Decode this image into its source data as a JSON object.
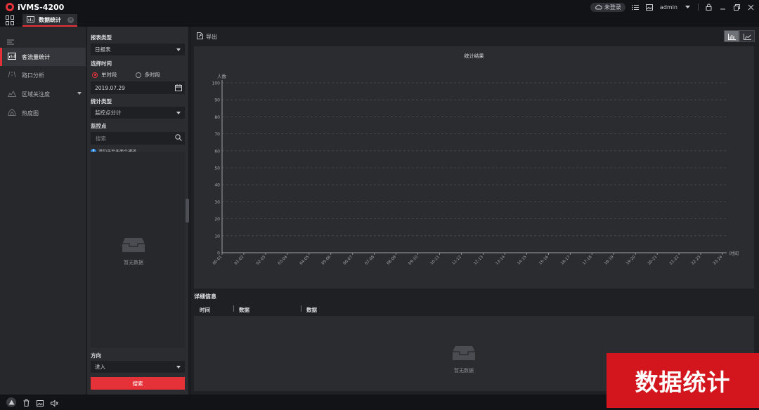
{
  "app": {
    "title": "iVMS-4200"
  },
  "titlebar": {
    "login_status": "未登录",
    "user": "admin"
  },
  "tabs": [
    {
      "label": "数据统计"
    }
  ],
  "nav": {
    "items": [
      {
        "label": "客流量统计",
        "icon": "people-counting-icon",
        "active": true
      },
      {
        "label": "路口分析",
        "icon": "intersection-icon",
        "active": false
      },
      {
        "label": "区域关注度",
        "icon": "area-heat-icon",
        "active": false,
        "expandable": true
      },
      {
        "label": "热度图",
        "icon": "heatmap-icon",
        "active": false
      }
    ]
  },
  "filters": {
    "report_type_label": "报表类型",
    "report_type_value": "日报表",
    "time_label": "选择时间",
    "time_single": "单时段",
    "time_multi": "多时段",
    "date_value": "2019.07.29",
    "stat_type_label": "统计类型",
    "stat_type_value": "监控点分计",
    "camera_label": "监控点",
    "search_placeholder": "搜索",
    "hint": "请勾选至多两个通道。",
    "empty_text": "暂无数据",
    "direction_label": "方向",
    "direction_value": "进入",
    "search_button": "搜索"
  },
  "toolbar": {
    "export_label": "导出"
  },
  "chart_data": {
    "type": "bar",
    "title": "统计结果",
    "ylabel": "人数",
    "xlabel": "时间",
    "ylim": [
      0,
      100
    ],
    "yticks": [
      0,
      10,
      20,
      30,
      40,
      50,
      60,
      70,
      80,
      90,
      100
    ],
    "grid": true,
    "categories": [
      "00-01",
      "01-02",
      "02-03",
      "03-04",
      "04-05",
      "05-06",
      "06-07",
      "07-08",
      "08-09",
      "09-10",
      "10-11",
      "11-12",
      "12-13",
      "13-14",
      "14-15",
      "15-16",
      "16-17",
      "17-18",
      "18-19",
      "19-20",
      "20-21",
      "21-22",
      "22-23",
      "23-24"
    ],
    "values": []
  },
  "detail": {
    "title": "详细信息",
    "columns": [
      "时间",
      "数据",
      "数据"
    ],
    "empty_text": "暂无数据"
  },
  "watermark": {
    "text": "数据统计"
  },
  "colors": {
    "accent": "#e53238",
    "panel": "#2a2c30",
    "background": "#1f2023"
  }
}
